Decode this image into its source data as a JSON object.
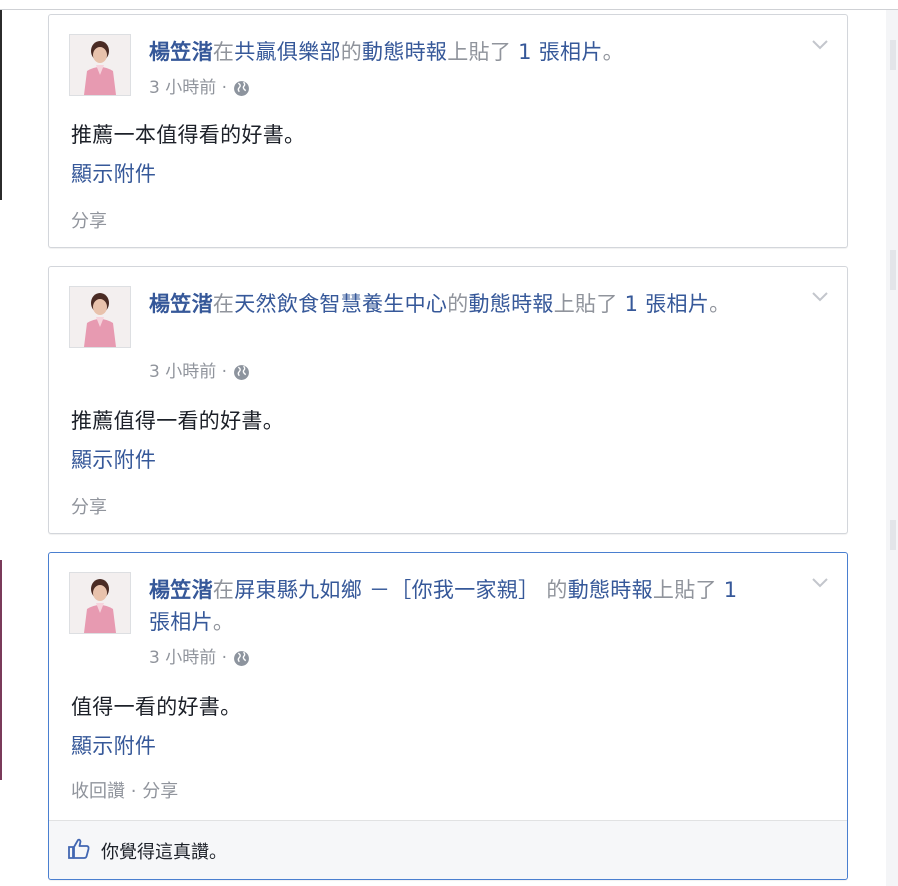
{
  "posts": [
    {
      "author": "楊笠湝",
      "pre": "在",
      "page": "共贏俱樂部",
      "mid": "的",
      "timeline": "動態時報",
      "post": "上貼了",
      "count": "1 張相片",
      "end": "。",
      "time": "3 小時前 ·",
      "text": "推薦一本值得看的好書。",
      "attachment": "顯示附件",
      "actions": [
        "分享"
      ]
    },
    {
      "author": "楊笠湝",
      "pre": "在",
      "page": "天然飲食智慧養生中心",
      "mid": "的",
      "timeline": "動態時報",
      "post": "上貼了",
      "count": "1 張相片",
      "end": "。",
      "time": "3 小時前 ·",
      "text": "推薦值得一看的好書。",
      "attachment": "顯示附件",
      "actions": [
        "分享"
      ]
    },
    {
      "author": "楊笠湝",
      "pre": "在",
      "page": "屏東縣九如鄉 －［你我一家親］",
      "mid": "的",
      "timeline": "動態時報",
      "post": "上貼了",
      "count": "1 張相片",
      "end": "。",
      "time": "3 小時前 ·",
      "text": "值得一看的好書。",
      "attachment": "顯示附件",
      "actions": [
        "收回讚",
        "·",
        "分享"
      ],
      "like_text": "你覺得這真讚。"
    }
  ],
  "icons": {
    "globe": "globe-icon",
    "chevron": "chevron-down-icon",
    "like": "thumbs-up-icon"
  },
  "colors": {
    "link": "#365899",
    "meta": "#90949c",
    "text": "#1d2129",
    "active_border": "#4a7fd0"
  }
}
